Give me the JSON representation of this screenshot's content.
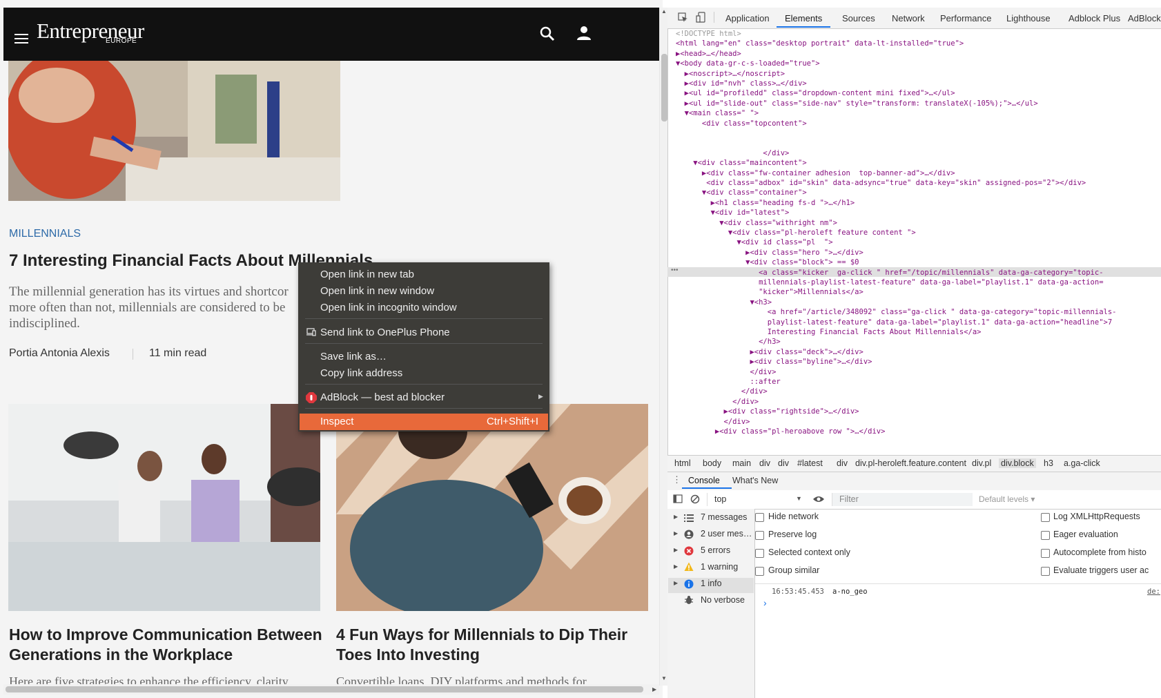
{
  "site": {
    "logo": "Entrepreneur",
    "logo_sub": "EUROPE",
    "kicker": "MILLENNIALS",
    "headline": "7 Interesting Financial Facts About Millennials",
    "deck_lines": [
      "The millennial generation has its virtues and shortcor",
      "more often than not, millennials are considered to be",
      "indisciplined."
    ],
    "author": "Portia Antonia Alexis",
    "read_time": "11 min read",
    "articles": [
      {
        "headline_lines": [
          "How to Improve Communication Between",
          "Generations in the Workplace"
        ],
        "deck": "Here are five strategies to enhance the efficiency, clarity"
      },
      {
        "headline_lines": [
          "4 Fun Ways for Millennials to Dip Their",
          "Toes Into Investing"
        ],
        "deck": "Convertible loans, DIY platforms and methods for"
      }
    ]
  },
  "context_menu": {
    "items": [
      "Open link in new tab",
      "Open link in new window",
      "Open link in incognito window",
      "Send link to OnePlus Phone",
      "Save link as…",
      "Copy link address",
      "AdBlock — best ad blocker",
      "Inspect"
    ],
    "inspect_shortcut": "Ctrl+Shift+I"
  },
  "devtools": {
    "tabs": [
      "Application",
      "Elements",
      "Sources",
      "Network",
      "Performance",
      "Lighthouse",
      "Adblock Plus",
      "AdBlock"
    ],
    "active_tab": "Elements",
    "code_lines": [
      "<!DOCTYPE html>",
      "<html lang=\"en\" class=\"desktop portrait\" data-lt-installed=\"true\">",
      "▶<head>…</head>",
      "▼<body data-gr-c-s-loaded=\"true\">",
      "  ▶<noscript>…</noscript>",
      "  ▶<div id=\"nvh\" class>…</div>",
      "  ▶<ul id=\"profiledd\" class=\"dropdown-content mini fixed\">…</ul>",
      "  ▶<ul id=\"slide-out\" class=\"side-nav\" style=\"transform: translateX(-105%);\">…</ul>",
      "  ▼<main class=\" \">",
      "      <div class=\"topcontent\">",
      "",
      "",
      "                    </div>",
      "    ▼<div class=\"maincontent\">",
      "      ▶<div class=\"fw-container adhesion  top-banner-ad\">…</div>",
      "       <div class=\"adbox\" id=\"skin\" data-adsync=\"true\" data-key=\"skin\" assigned-pos=\"2\"></div>",
      "      ▼<div class=\"container\">",
      "        ▶<h1 class=\"heading fs-d \">…</h1>",
      "        ▼<div id=\"latest\">",
      "          ▼<div class=\"withright nm\">",
      "            ▼<div class=\"pl-heroleft feature content \">",
      "              ▼<div id class=\"pl  \">",
      "                ▶<div class=\"hero \">…</div>",
      "                ▼<div class=\"block\"> == $0",
      "                   <a class=\"kicker  ga-click \" href=\"/topic/millennials\" data-ga-category=\"topic-",
      "                   millennials-playlist-latest-feature\" data-ga-label=\"playlist.1\" data-ga-action=",
      "                   \"kicker\">Millennials</a>",
      "                 ▼<h3>",
      "                     <a href=\"/article/348092\" class=\"ga-click \" data-ga-category=\"topic-millennials-",
      "                     playlist-latest-feature\" data-ga-label=\"playlist.1\" data-ga-action=\"headline\">7",
      "                     Interesting Financial Facts About Millennials</a>",
      "                   </h3>",
      "                 ▶<div class=\"deck\">…</div>",
      "                 ▶<div class=\"byline\">…</div>",
      "                 </div>",
      "                 ::after",
      "               </div>",
      "             </div>",
      "           ▶<div class=\"rightside\">…</div>",
      "           </div>",
      "         ▶<div class=\"pl-heroabove row \">…</div>"
    ],
    "breadcrumbs": [
      "html",
      "body",
      "main",
      "div",
      "div",
      "#latest",
      "div",
      "div.pl-heroleft.feature.content",
      "div.pl",
      "div.block",
      "h3",
      "a.ga-click"
    ],
    "drawer_tabs": [
      "Console",
      "What's New"
    ],
    "context_select": "top",
    "filter_placeholder": "Filter",
    "levels": "Default levels ▾",
    "sidebar": [
      "7 messages",
      "2 user mes…",
      "5 errors",
      "1 warning",
      "1 info",
      "No verbose"
    ],
    "options_left": [
      "Hide network",
      "Preserve log",
      "Selected context only",
      "Group similar"
    ],
    "options_right": [
      "Log XMLHttpRequests",
      "Eager evaluation",
      "Autocomplete from histo",
      "Evaluate triggers user ac"
    ],
    "log_time": "16:53:45.453",
    "log_text": "a-no_geo",
    "log_source": "de:",
    "prompt": "›"
  }
}
